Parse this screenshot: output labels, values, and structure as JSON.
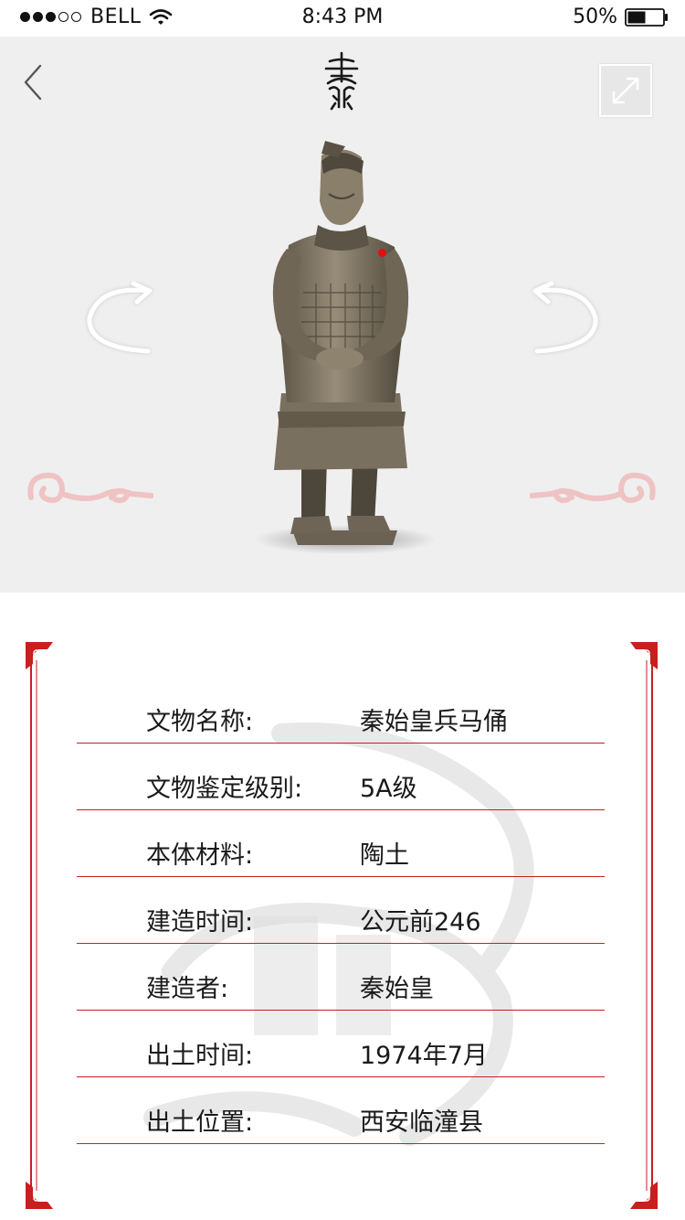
{
  "status_bar": {
    "carrier": "BELL",
    "time": "8:43 PM",
    "battery": "50%"
  },
  "header": {
    "back_icon": "chevron-left-icon",
    "logo": "qin-seal-logo",
    "expand_icon": "expand-icon"
  },
  "viewer": {
    "rotate_left_icon": "rotate-left-icon",
    "rotate_right_icon": "rotate-right-icon",
    "artifact_image": "terracotta-warrior-statue"
  },
  "info": {
    "rows": [
      {
        "label": "文物名称:",
        "value": "秦始皇兵马俑"
      },
      {
        "label": "文物鉴定级别:",
        "value": "5A级"
      },
      {
        "label": "本体材料:",
        "value": "陶土"
      },
      {
        "label": "建造时间:",
        "value": "公元前246"
      },
      {
        "label": "建造者:",
        "value": "秦始皇"
      },
      {
        "label": "出土时间:",
        "value": "1974年7月"
      },
      {
        "label": "出土位置:",
        "value": "西安临潼县"
      }
    ]
  },
  "colors": {
    "accent_red": "#c91f1f",
    "hero_bg": "#efefef",
    "cloud_pink": "#efc3c3"
  }
}
